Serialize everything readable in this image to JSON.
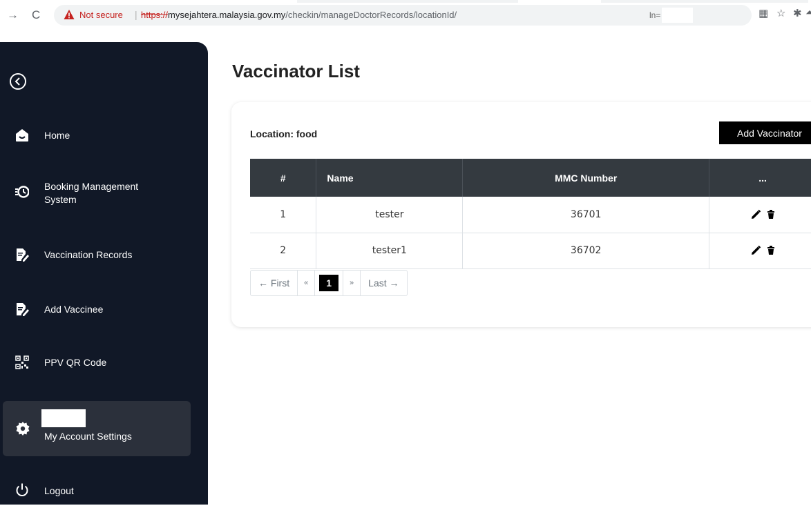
{
  "browser": {
    "security_label": "Not secure",
    "url_scheme": "https://",
    "url_host": "mysejahtera.malaysia.gov.my",
    "url_path": "/checkin/manageDoctorRecords/locationId/",
    "url_suffix": "ln="
  },
  "sidebar": {
    "items": [
      {
        "label": "Home",
        "icon": "home-icon"
      },
      {
        "label": "Booking Management System",
        "icon": "booking-clock-icon"
      },
      {
        "label": "Vaccination Records",
        "icon": "records-edit-icon"
      },
      {
        "label": "Add Vaccinee",
        "icon": "add-vaccinee-icon"
      },
      {
        "label": "PPV QR Code",
        "icon": "qr-code-icon"
      },
      {
        "label": "My Account Settings",
        "icon": "gear-icon"
      },
      {
        "label": "Logout",
        "icon": "power-icon"
      }
    ],
    "booking_line1": "Booking Management",
    "booking_line2": "System"
  },
  "main": {
    "title": "Vaccinator List",
    "location": "Location: food",
    "add_button": "Add Vaccinator",
    "columns": [
      "#",
      "Name",
      "MMC Number",
      "..."
    ],
    "rows": [
      {
        "num": "1",
        "name": "tester",
        "mmc": "36701"
      },
      {
        "num": "2",
        "name": "tester1",
        "mmc": "36702"
      }
    ],
    "pagination": {
      "first": "← First",
      "prev": "«",
      "current": "1",
      "next": "»",
      "last": "Last →"
    }
  },
  "colors": {
    "sidebar_bg": "#111827",
    "active_item_bg": "#2b303b",
    "table_header_bg": "#343a40",
    "accent": "#000000",
    "insecure_red": "#c5221f"
  }
}
